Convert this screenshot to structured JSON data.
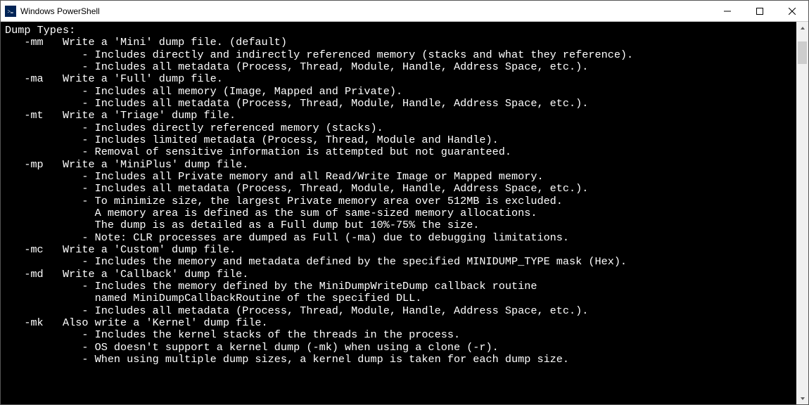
{
  "window": {
    "title": "Windows PowerShell"
  },
  "terminal": {
    "header": "Dump Types:",
    "options": [
      {
        "flag": "-mm",
        "desc": "Write a 'Mini' dump file. (default)",
        "lines": [
          "- Includes directly and indirectly referenced memory (stacks and what they reference).",
          "- Includes all metadata (Process, Thread, Module, Handle, Address Space, etc.)."
        ]
      },
      {
        "flag": "-ma",
        "desc": "Write a 'Full' dump file.",
        "lines": [
          "- Includes all memory (Image, Mapped and Private).",
          "- Includes all metadata (Process, Thread, Module, Handle, Address Space, etc.)."
        ]
      },
      {
        "flag": "-mt",
        "desc": "Write a 'Triage' dump file.",
        "lines": [
          "- Includes directly referenced memory (stacks).",
          "- Includes limited metadata (Process, Thread, Module and Handle).",
          "- Removal of sensitive information is attempted but not guaranteed."
        ]
      },
      {
        "flag": "-mp",
        "desc": "Write a 'MiniPlus' dump file.",
        "lines": [
          "- Includes all Private memory and all Read/Write Image or Mapped memory.",
          "- Includes all metadata (Process, Thread, Module, Handle, Address Space, etc.).",
          "- To minimize size, the largest Private memory area over 512MB is excluded.",
          "  A memory area is defined as the sum of same-sized memory allocations.",
          "  The dump is as detailed as a Full dump but 10%-75% the size.",
          "- Note: CLR processes are dumped as Full (-ma) due to debugging limitations."
        ]
      },
      {
        "flag": "-mc",
        "desc": "Write a 'Custom' dump file.",
        "lines": [
          "- Includes the memory and metadata defined by the specified MINIDUMP_TYPE mask (Hex)."
        ]
      },
      {
        "flag": "-md",
        "desc": "Write a 'Callback' dump file.",
        "lines": [
          "- Includes the memory defined by the MiniDumpWriteDump callback routine",
          "  named MiniDumpCallbackRoutine of the specified DLL.",
          "- Includes all metadata (Process, Thread, Module, Handle, Address Space, etc.)."
        ]
      },
      {
        "flag": "-mk",
        "desc": "Also write a 'Kernel' dump file.",
        "lines": [
          "- Includes the kernel stacks of the threads in the process.",
          "- OS doesn't support a kernel dump (-mk) when using a clone (-r).",
          "- When using multiple dump sizes, a kernel dump is taken for each dump size."
        ]
      }
    ]
  }
}
